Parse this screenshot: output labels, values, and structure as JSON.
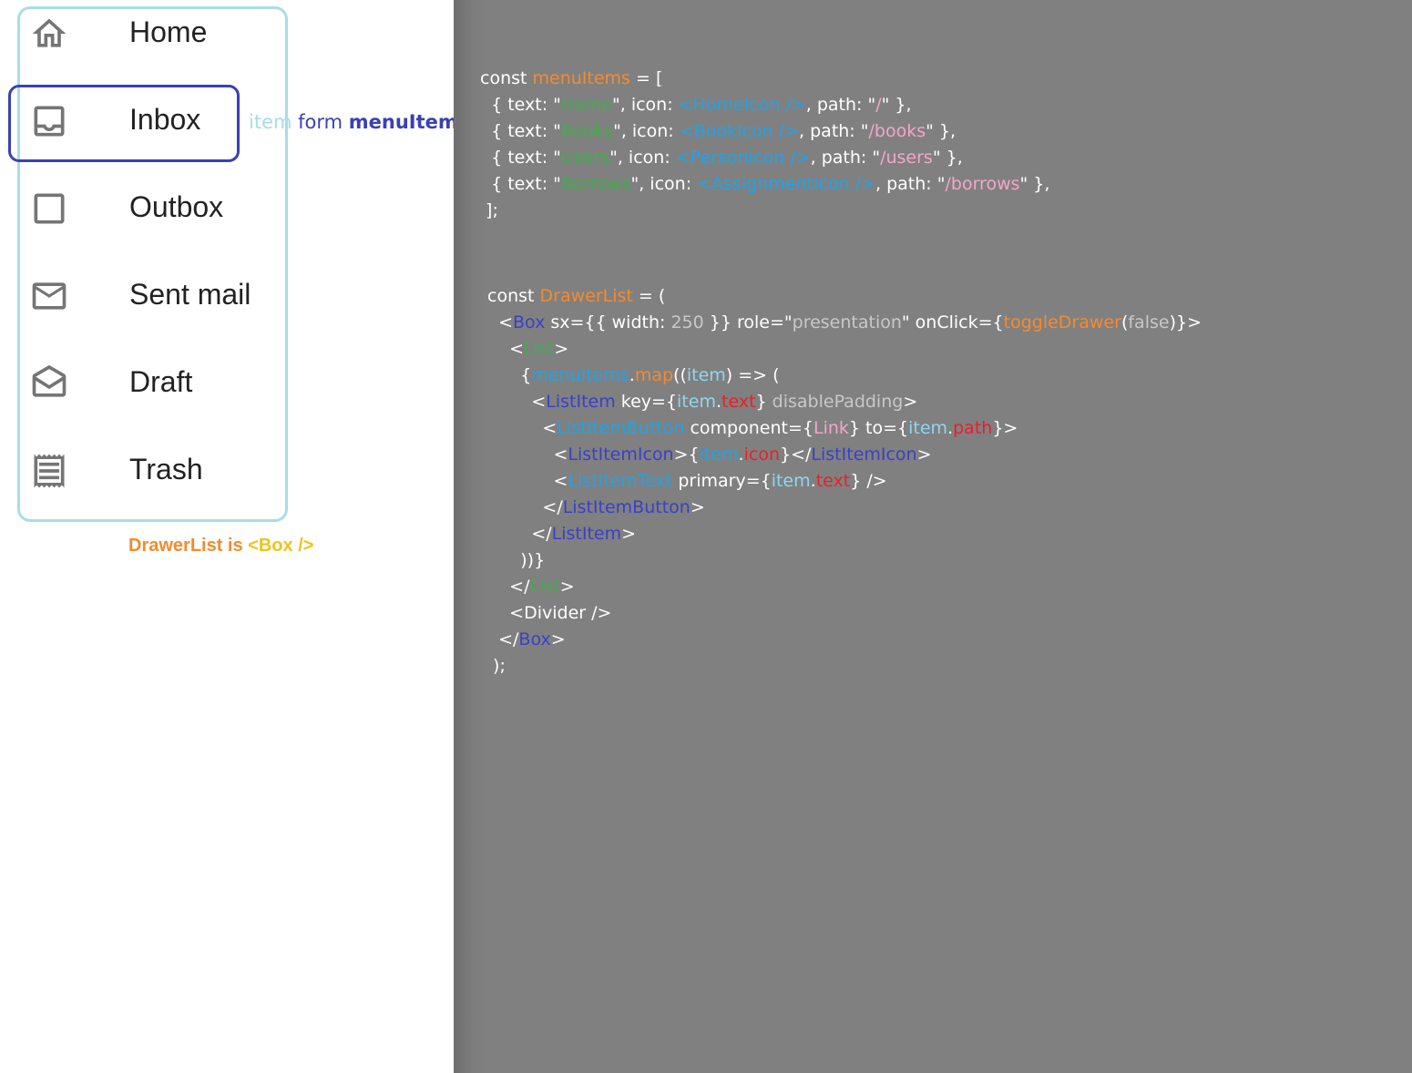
{
  "drawer": {
    "items": [
      {
        "label": "Home",
        "icon": "home-icon"
      },
      {
        "label": "Inbox",
        "icon": "inbox-icon"
      },
      {
        "label": "Outbox",
        "icon": "outbox-icon"
      },
      {
        "label": "Sent mail",
        "icon": "mail-icon"
      },
      {
        "label": "Draft",
        "icon": "drafts-icon"
      },
      {
        "label": "Trash",
        "icon": "receipt-icon"
      }
    ]
  },
  "annotations": {
    "item_form": {
      "part1": "item",
      "part2": " form ",
      "part3": "menuItems"
    },
    "drawer_note": {
      "part1": "DrawerList is ",
      "part2": "<Box />"
    }
  },
  "colors": {
    "frame_cyan": "#a8dde9",
    "highlight_blue": "#3a40b8",
    "code_bg": "#808080",
    "tok_white": "#ffffff",
    "tok_orange": "#f58a2e",
    "tok_green": "#3fae49",
    "tok_blue": "#1fa3e8",
    "tok_pink": "#f4a6c8",
    "tok_lightblue": "#8fd6ef",
    "tok_navy": "#3a40c8",
    "tok_red": "#e8202a",
    "tok_gray": "#c8c8c8",
    "tok_yellow": "#f2c21b"
  },
  "code": {
    "lines": [
      [
        [
          "const ",
          "tok_white"
        ],
        [
          "menuItems",
          "tok_orange"
        ],
        [
          " = [",
          "tok_white"
        ]
      ],
      [
        [
          "  { text: \"",
          "tok_white"
        ],
        [
          "Home",
          "tok_green"
        ],
        [
          "\", icon: ",
          "tok_white"
        ],
        [
          "<HomeIcon />",
          "tok_blue"
        ],
        [
          ", path: \"",
          "tok_white"
        ],
        [
          "/",
          "tok_pink"
        ],
        [
          "\" },",
          "tok_white"
        ]
      ],
      [
        [
          "  { text: \"",
          "tok_white"
        ],
        [
          "Books",
          "tok_green"
        ],
        [
          "\", icon: ",
          "tok_white"
        ],
        [
          "<BookIcon />",
          "tok_blue"
        ],
        [
          ", path: \"",
          "tok_white"
        ],
        [
          "/books",
          "tok_pink"
        ],
        [
          "\" },",
          "tok_white"
        ]
      ],
      [
        [
          "  { text: \"",
          "tok_white"
        ],
        [
          "Users",
          "tok_green"
        ],
        [
          "\", icon: ",
          "tok_white"
        ],
        [
          "<PersonIcon />",
          "tok_blue"
        ],
        [
          ", path: \"",
          "tok_white"
        ],
        [
          "/users",
          "tok_pink"
        ],
        [
          "\" },",
          "tok_white"
        ]
      ],
      [
        [
          "  { text: \"",
          "tok_white"
        ],
        [
          "Borrows",
          "tok_green"
        ],
        [
          "\", icon: ",
          "tok_white"
        ],
        [
          "<AssignmentIcon />",
          "tok_blue"
        ],
        [
          ", path: \"",
          "tok_white"
        ],
        [
          "/borrows",
          "tok_pink"
        ],
        [
          "\" },",
          "tok_white"
        ]
      ],
      [
        [
          " ];",
          "tok_white"
        ]
      ],
      [
        [
          "const ",
          "tok_white"
        ],
        [
          "DrawerList",
          "tok_orange"
        ],
        [
          " = (",
          "tok_white"
        ]
      ],
      [
        [
          "  <",
          "tok_white"
        ],
        [
          "Box",
          "tok_navy"
        ],
        [
          " sx={{ width: ",
          "tok_white"
        ],
        [
          "250",
          "tok_gray"
        ],
        [
          " }} role=\"",
          "tok_white"
        ],
        [
          "presentation",
          "tok_gray"
        ],
        [
          "\" onClick={",
          "tok_white"
        ],
        [
          "toggleDrawer",
          "tok_orange"
        ],
        [
          "(",
          "tok_white"
        ],
        [
          "false",
          "tok_gray"
        ],
        [
          ")}>",
          "tok_white"
        ]
      ],
      [
        [
          "    <",
          "tok_white"
        ],
        [
          "List",
          "tok_green"
        ],
        [
          ">",
          "tok_white"
        ]
      ],
      [
        [
          "      {",
          "tok_white"
        ],
        [
          "menuItems",
          "tok_blue"
        ],
        [
          ".",
          "tok_white"
        ],
        [
          "map",
          "tok_orange"
        ],
        [
          "((",
          "tok_white"
        ],
        [
          "item",
          "tok_lightblue"
        ],
        [
          ") => (",
          "tok_white"
        ]
      ],
      [
        [
          "        <",
          "tok_white"
        ],
        [
          "ListItem",
          "tok_navy"
        ],
        [
          " key={",
          "tok_white"
        ],
        [
          "item",
          "tok_lightblue"
        ],
        [
          ".",
          "tok_white"
        ],
        [
          "text",
          "tok_red"
        ],
        [
          "} ",
          "tok_white"
        ],
        [
          "disablePadding",
          "tok_gray"
        ],
        [
          ">",
          "tok_white"
        ]
      ],
      [
        [
          "          <",
          "tok_white"
        ],
        [
          "ListItemButton",
          "tok_blue"
        ],
        [
          " component={",
          "tok_white"
        ],
        [
          "Link",
          "tok_pink"
        ],
        [
          "} to={",
          "tok_white"
        ],
        [
          "item",
          "tok_lightblue"
        ],
        [
          ".",
          "tok_white"
        ],
        [
          "path",
          "tok_red"
        ],
        [
          "}>",
          "tok_white"
        ]
      ],
      [
        [
          "            <",
          "tok_white"
        ],
        [
          "ListItemIcon",
          "tok_navy"
        ],
        [
          ">{",
          "tok_white"
        ],
        [
          "item",
          "tok_blue"
        ],
        [
          ".",
          "tok_white"
        ],
        [
          "icon",
          "tok_red"
        ],
        [
          "}</",
          "tok_white"
        ],
        [
          "ListItemIcon",
          "tok_navy"
        ],
        [
          ">",
          "tok_white"
        ]
      ],
      [
        [
          "            <",
          "tok_white"
        ],
        [
          "ListItemText",
          "tok_blue"
        ],
        [
          " primary={",
          "tok_white"
        ],
        [
          "item",
          "tok_lightblue"
        ],
        [
          ".",
          "tok_white"
        ],
        [
          "text",
          "tok_red"
        ],
        [
          "} />",
          "tok_white"
        ]
      ],
      [
        [
          "          </",
          "tok_white"
        ],
        [
          "ListItemButton",
          "tok_navy"
        ],
        [
          ">",
          "tok_white"
        ]
      ],
      [
        [
          "        </",
          "tok_white"
        ],
        [
          "ListItem",
          "tok_navy"
        ],
        [
          ">",
          "tok_white"
        ]
      ],
      [
        [
          "      ))}",
          "tok_white"
        ]
      ],
      [
        [
          "    </",
          "tok_white"
        ],
        [
          "List",
          "tok_green"
        ],
        [
          ">",
          "tok_white"
        ]
      ],
      [
        [
          "    <Divider />",
          "tok_white"
        ]
      ],
      [
        [
          "  </",
          "tok_white"
        ],
        [
          "Box",
          "tok_navy"
        ],
        [
          ">",
          "tok_white"
        ]
      ],
      [
        [
          " );",
          "tok_white"
        ]
      ]
    ]
  }
}
